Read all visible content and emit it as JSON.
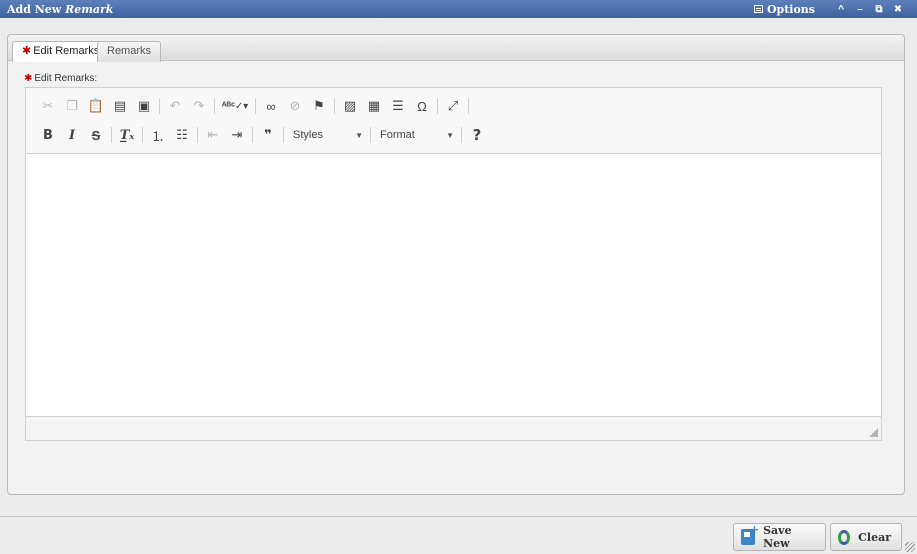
{
  "window": {
    "title_prefix": "Add New ",
    "title_emphasis": "Remark",
    "options_label": "Options",
    "controls": {
      "collapse": "^",
      "minimize": "–",
      "restore": "⧉",
      "close": "✖"
    }
  },
  "tabs": [
    {
      "label": "Edit Remarks",
      "required": true,
      "active": true
    },
    {
      "label": "Remarks",
      "required": false,
      "active": false
    }
  ],
  "required_marker": "✱",
  "field": {
    "label": "Edit Remarks:"
  },
  "editor": {
    "value": "",
    "toolbar_row1": [
      "cut-icon",
      "copy-icon",
      "paste-icon",
      "paste-text-icon",
      "paste-word-icon",
      "undo-icon",
      "redo-icon",
      "spellcheck-icon",
      "link-icon",
      "unlink-icon",
      "anchor-icon",
      "image-icon",
      "table-icon",
      "horizontal-rule-icon",
      "special-char-icon",
      "maximize-icon"
    ],
    "toolbar_row2": [
      "bold-icon",
      "italic-icon",
      "strike-icon",
      "remove-format-icon",
      "numbered-list-icon",
      "bulleted-list-icon",
      "outdent-icon",
      "indent-icon",
      "blockquote-icon",
      "help-icon"
    ],
    "styles_label": "Styles",
    "format_label": "Format"
  },
  "footer": {
    "save_new_label": "Save New",
    "clear_label": "Clear"
  },
  "colors": {
    "titlebar": "#4a6daa",
    "required": "#c00000",
    "save_icon": "#3d84c6"
  }
}
